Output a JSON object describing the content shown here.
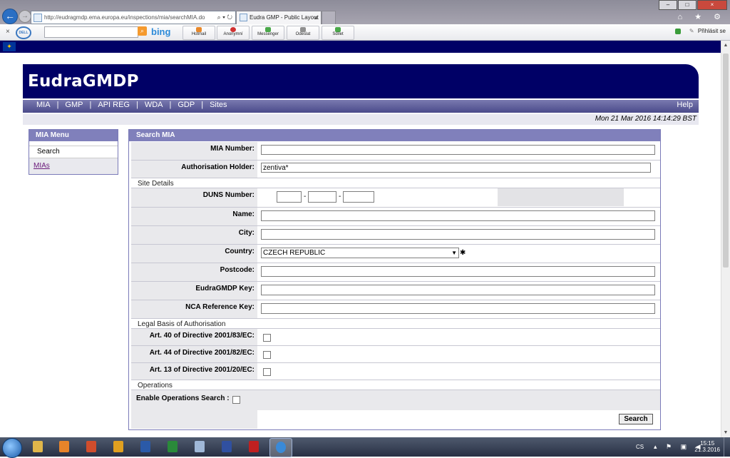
{
  "browser": {
    "address_url": "http://eudragmdp.ema.europa.eu/inspections/mia/searchMIA.do",
    "address_tools": "⌕ ▾ ↻",
    "tab_title": "Eudra GMP - Public Layout",
    "tab_close": "×",
    "back_glyph": "←",
    "fwd_glyph": "→",
    "window_controls": [
      "–",
      "□",
      "×"
    ],
    "chrome_icons": "⌂ ★ ⚙"
  },
  "toolbar": {
    "close_glyph": "×",
    "dell_label": "DELL",
    "bing_search_glyph": "⌕",
    "bing_label": "bing",
    "buttons": [
      {
        "label": "Hotmail",
        "color": "#e8882a"
      },
      {
        "label": "Anonymní",
        "color": "#d03030"
      },
      {
        "label": "Messenger",
        "color": "#4aa84a"
      },
      {
        "label": "Odeslat",
        "color": "#8f8f8f"
      },
      {
        "label": "Sdílet",
        "color": "#4aa84a"
      }
    ],
    "signin_label": "Přihlásit se"
  },
  "page": {
    "eu_flag_glyph": "✦",
    "site_title": "EudraGMDP",
    "nav": [
      "MIA",
      "GMP",
      "API REG",
      "WDA",
      "GDP",
      "Sites"
    ],
    "nav_sep": "|",
    "help": "Help",
    "datestamp": "Mon 21 Mar 2016 14:14:29 BST",
    "menu": {
      "title": "MIA Menu",
      "items": [
        "Search",
        "MIAs"
      ]
    },
    "form": {
      "title": "Search MIA",
      "mia_number_label": "MIA Number:",
      "mia_number_value": "",
      "holder_label": "Authorisation Holder:",
      "holder_value": "zentiva*",
      "site_details_section": "Site Details",
      "duns_label": "DUNS Number:",
      "duns_sep": "-",
      "name_label": "Name:",
      "city_label": "City:",
      "country_label": "Country:",
      "country_value": "CZECH REPUBLIC",
      "country_arrow": "▼",
      "required_mark": "✱",
      "postcode_label": "Postcode:",
      "eudragmdp_key_label": "EudraGMDP Key:",
      "nca_ref_label": "NCA Reference Key:",
      "legal_section": "Legal Basis of Authorisation",
      "art40_label": "Art. 40 of Directive 2001/83/EC:",
      "art44_label": "Art. 44 of Directive 2001/82/EC:",
      "art13_label": "Art. 13 of Directive 2001/20/EC:",
      "operations_section": "Operations",
      "enable_ops_label": "Enable Operations Search :",
      "search_button": "Search"
    },
    "colors": {
      "navy": "#000066",
      "menu_header": "#8080bb",
      "label_bg": "#e9e9ec"
    }
  },
  "scrollbar": {
    "up_glyph": "▲",
    "down_glyph": "▼"
  },
  "taskbar": {
    "apps": [
      {
        "name": "explorer",
        "color": "#e0b64a"
      },
      {
        "name": "media",
        "color": "#e8842a"
      },
      {
        "name": "powerpoint",
        "color": "#d04d2c"
      },
      {
        "name": "outlook",
        "color": "#e0a020"
      },
      {
        "name": "word",
        "color": "#2b5aa8"
      },
      {
        "name": "excel",
        "color": "#2a8a3a"
      },
      {
        "name": "notepad",
        "color": "#a0b8d8"
      },
      {
        "name": "save",
        "color": "#3050a0"
      },
      {
        "name": "acrobat",
        "color": "#c02020"
      },
      {
        "name": "internet-explorer",
        "color": "#3a8ad8"
      }
    ],
    "language": "CS",
    "tray_icons": "▴ ⚑ ▣ ◀",
    "time": "15:15",
    "date": "21.3.2016"
  }
}
